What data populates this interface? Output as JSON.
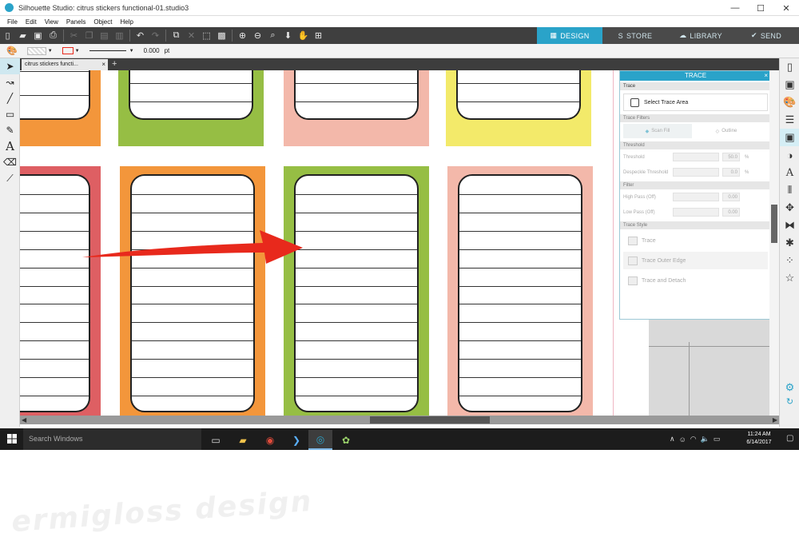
{
  "window": {
    "title": "Silhouette Studio: citrus stickers functional-01.studio3",
    "minimize": "—",
    "maximize": "☐",
    "close": "✕"
  },
  "menu": [
    "File",
    "Edit",
    "View",
    "Panels",
    "Object",
    "Help"
  ],
  "mode_tabs": [
    {
      "label": "DESIGN",
      "active": true
    },
    {
      "label": "STORE",
      "active": false
    },
    {
      "label": "LIBRARY",
      "active": false
    },
    {
      "label": "SEND",
      "active": false
    }
  ],
  "options": {
    "line_width_value": "0.000",
    "line_width_unit": "pt"
  },
  "document_tab": {
    "name": "citrus stickers functi...",
    "close": "×",
    "add": "+"
  },
  "trace_panel": {
    "title": "TRACE",
    "close": "×",
    "section_trace": "Trace",
    "select_area": "Select Trace Area",
    "section_filters": "Trace Filters",
    "filter_scan": "Scan Fill",
    "filter_outline": "Outline",
    "section_threshold": "Threshold",
    "threshold_label": "Threshold",
    "threshold_value": "50.0",
    "threshold_unit": "%",
    "despeckle_label": "Despeckle Threshold",
    "despeckle_value": "0.0",
    "despeckle_unit": "%",
    "section_filter": "Filter",
    "highpass_label": "High Pass (Off)",
    "highpass_value": "0.00",
    "lowpass_label": "Low Pass (Off)",
    "lowpass_value": "0.00",
    "section_style": "Trace Style",
    "action_trace": "Trace",
    "action_outer": "Trace Outer Edge",
    "action_detach": "Trace and Detach"
  },
  "taskbar": {
    "search_placeholder": "Search Windows",
    "time": "11:24 AM",
    "date": "6/14/2017"
  },
  "watermark": "ermigloss design",
  "colors": {
    "accent": "#2aa3c9",
    "sticker_green": "#96be44",
    "sticker_orange": "#f3963b",
    "sticker_pink": "#f3b8aa",
    "sticker_yellow": "#f3ea6a",
    "sticker_red": "#de5f63",
    "arrow_red": "#e8291c"
  }
}
